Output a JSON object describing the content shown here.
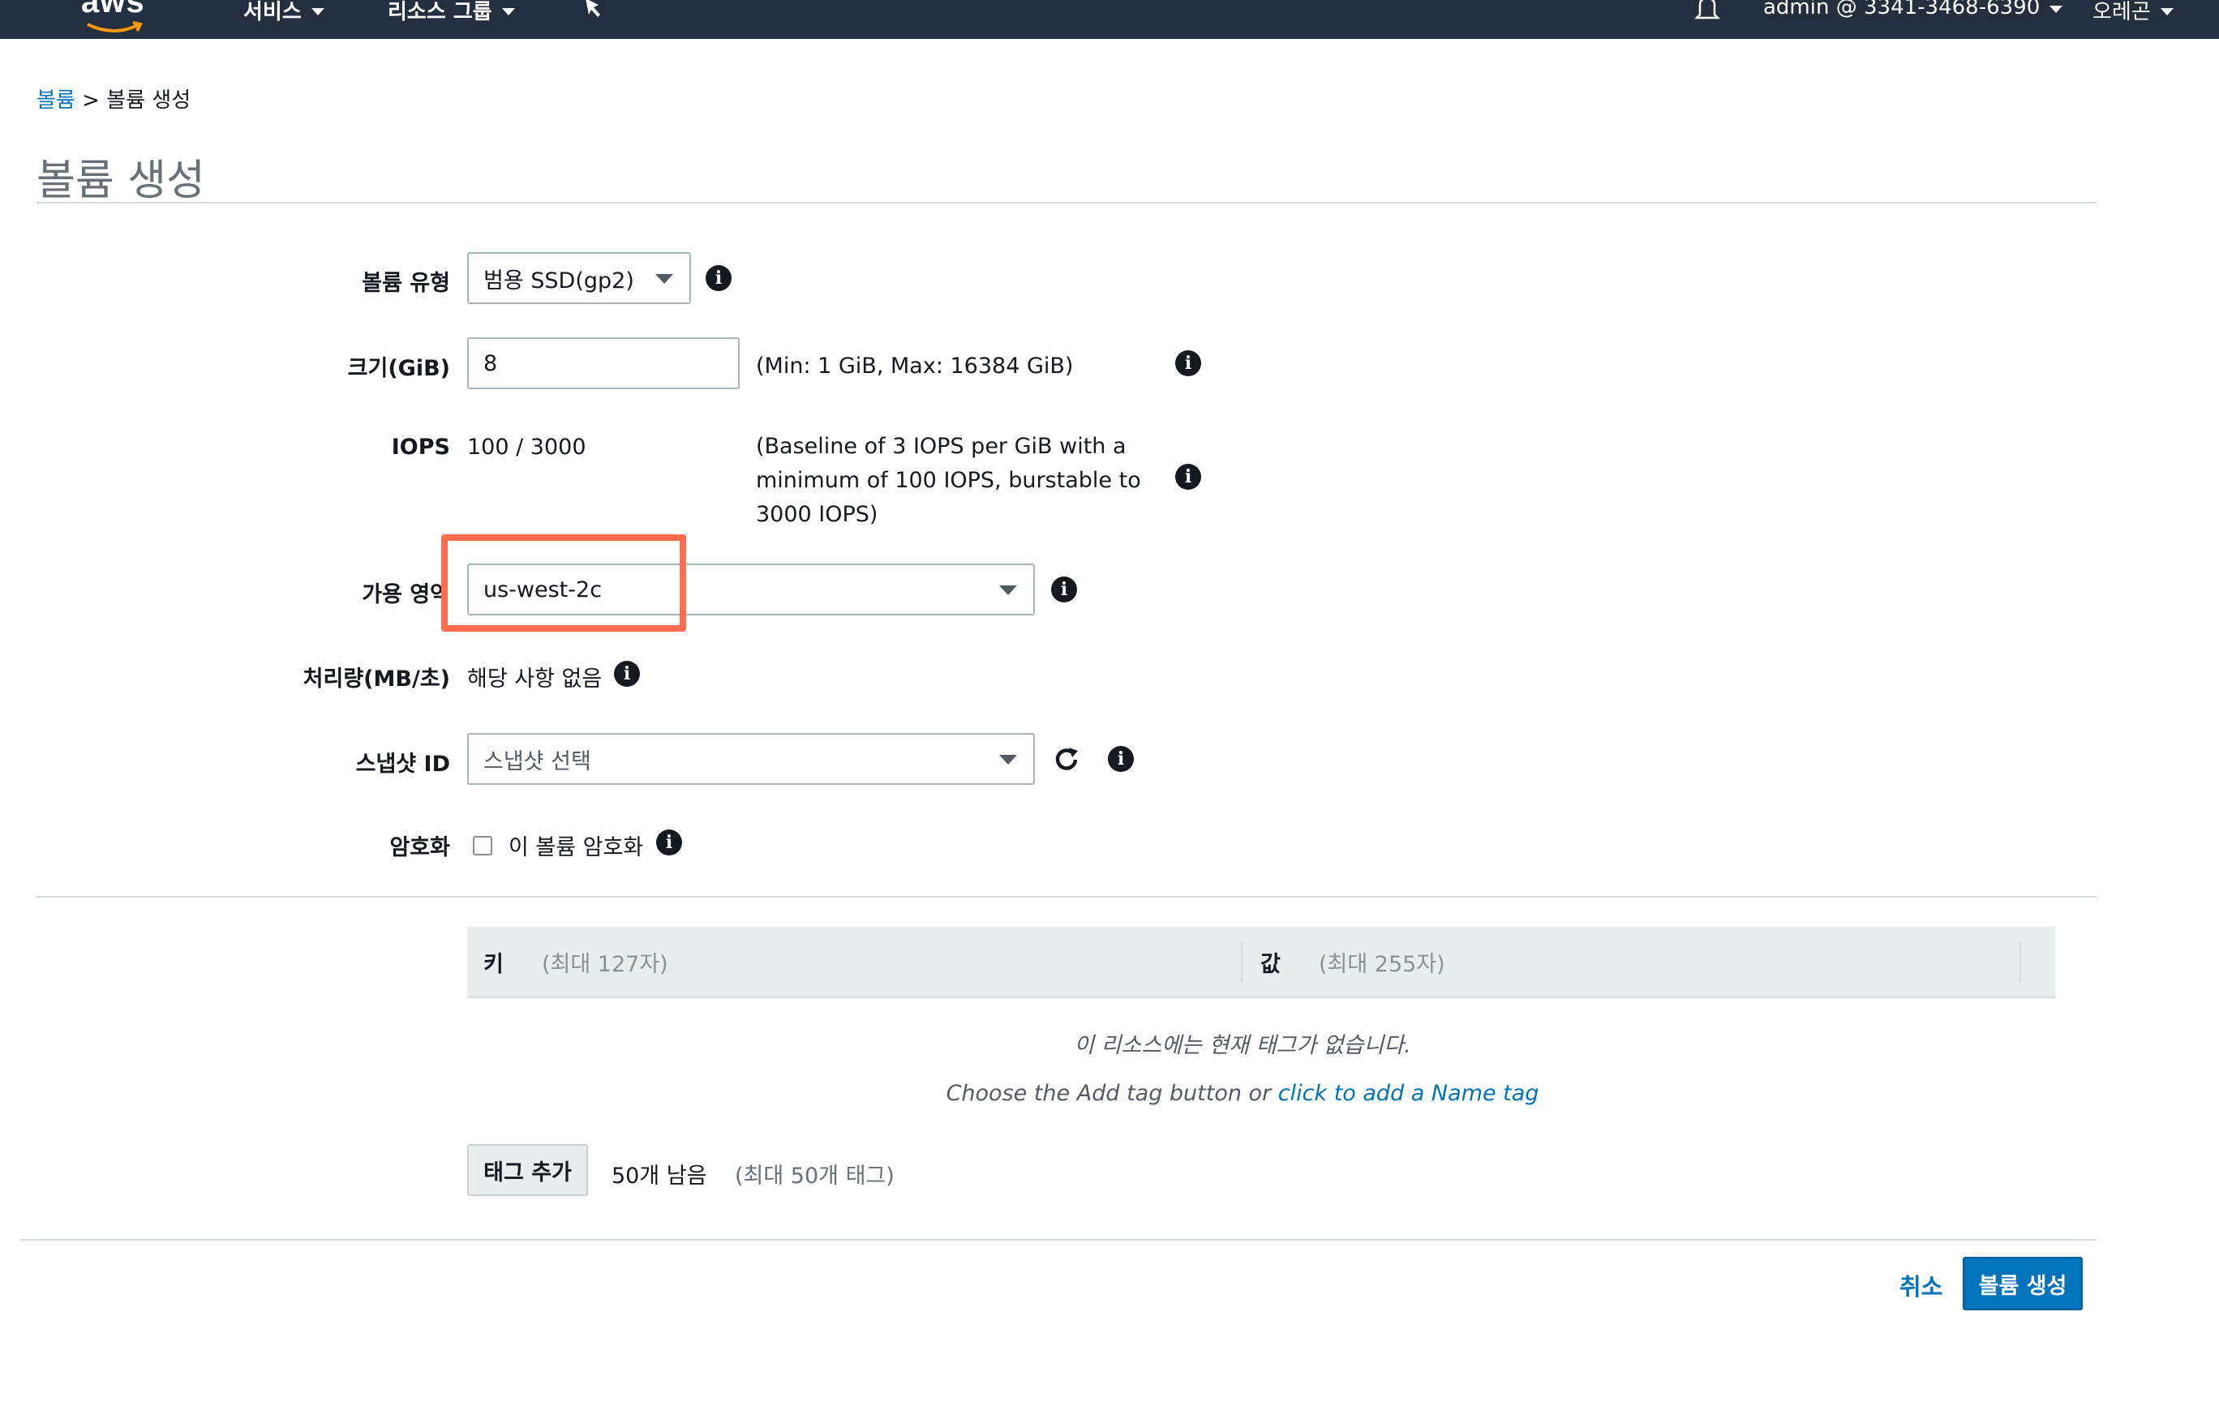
{
  "nav": {
    "logo": "aws",
    "services": "서비스",
    "resource_groups": "리소스 그룹",
    "account": "admin @ 3341-3468-6390",
    "region": "오레곤"
  },
  "breadcrumb": {
    "parent": "볼륨",
    "separator": ">",
    "current": "볼륨 생성"
  },
  "page_title": "볼륨 생성",
  "form": {
    "volume_type": {
      "label": "볼륨 유형",
      "value": "범용 SSD(gp2)"
    },
    "size": {
      "label": "크기(GiB)",
      "value": "8",
      "hint": "(Min: 1 GiB, Max: 16384 GiB)"
    },
    "iops": {
      "label": "IOPS",
      "value": "100 / 3000",
      "hint": "(Baseline of 3 IOPS per GiB with a minimum of 100 IOPS, burstable to 3000 IOPS)"
    },
    "availability_zone": {
      "label": "가용 영역",
      "value": "us-west-2c"
    },
    "throughput": {
      "label": "처리량(MB/초)",
      "value": "해당 사항 없음"
    },
    "snapshot": {
      "label": "스냅샷 ID",
      "placeholder": "스냅샷 선택"
    },
    "encryption": {
      "label": "암호화",
      "checkbox_label": "이 볼륨 암호화",
      "checked": false
    }
  },
  "tags": {
    "key_header": "키",
    "key_hint": "(최대 127자)",
    "value_header": "값",
    "value_hint": "(최대 255자)",
    "empty_message": "이 리소스에는 현재 태그가 없습니다.",
    "choose_prefix": "Choose the Add tag button or",
    "add_name_link": "click to add a Name tag",
    "add_button": "태그 추가",
    "remaining": "50개 남음",
    "max_hint": "(최대 50개 태그)"
  },
  "footer": {
    "cancel": "취소",
    "create": "볼륨 생성"
  },
  "colors": {
    "nav_bg": "#232f3e",
    "primary": "#0073bb",
    "highlight": "#ff6d4e"
  }
}
